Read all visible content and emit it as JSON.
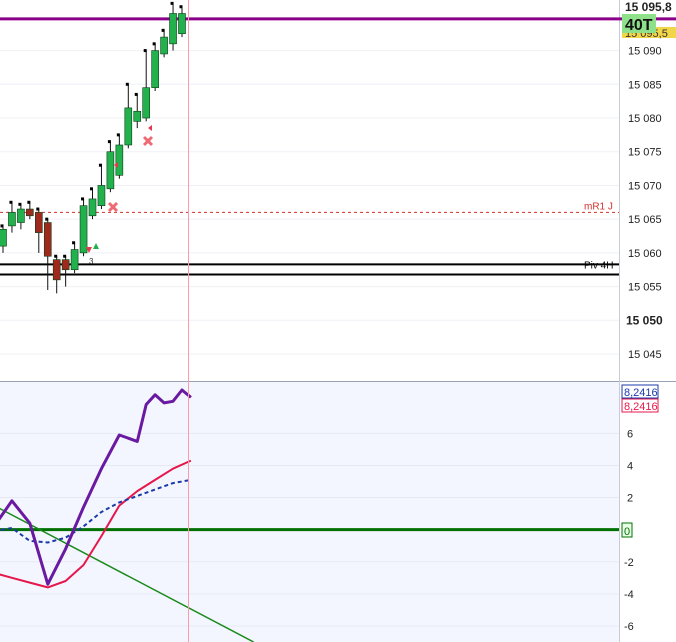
{
  "colors": {
    "bull": "#22b14c",
    "bear": "#a0291d",
    "wick": "#111111",
    "mr1": "#d0312d",
    "resistance": "#8b008b",
    "pivot": "#000000",
    "zero": "#007000",
    "trend": "#1a8a1a",
    "osc_fast": "#6a1aa0",
    "osc_slow": "#e5174b",
    "osc_signal": "#1a3aa8",
    "cursor": "#ff9aa8"
  },
  "price_axis": {
    "ticks": [
      "15 090",
      "15 085",
      "15 080",
      "15 075",
      "15 070",
      "15 065",
      "15 060",
      "15 055",
      "15 050",
      "15 045"
    ],
    "bold_tick": "15 050",
    "top_label": "15 095,8",
    "timeframe_badge": "40T",
    "last_price_badge": "15 095,5"
  },
  "osc_axis": {
    "ticks": [
      "6",
      "4",
      "2",
      "0",
      "-2",
      "-4",
      "-6"
    ],
    "value_badge_1": "8,2416",
    "value_badge_2": "8,2416",
    "zero_badge": "0"
  },
  "levels": {
    "mr1_label": "mR1 J",
    "pivot_label": "Piv 4H"
  },
  "markers": {
    "count_label": "3"
  },
  "chart_data": [
    {
      "type": "candlestick",
      "ylim": [
        15041,
        15097.5
      ],
      "resistance_level": 15094.7,
      "levels": [
        {
          "name": "mR1 J",
          "value": 15066.0,
          "style": "dashed"
        },
        {
          "name": "Piv 4H",
          "value": 15058.3,
          "style": "solid"
        },
        {
          "name": "",
          "value": 15056.8,
          "style": "solid"
        }
      ],
      "last_price": 15095.5,
      "candles": [
        {
          "o": 15061.0,
          "h": 15064.0,
          "l": 15060.0,
          "c": 15063.5
        },
        {
          "o": 15064.0,
          "h": 15067.5,
          "l": 15063.0,
          "c": 15066.0
        },
        {
          "o": 15064.5,
          "h": 15067.2,
          "l": 15063.5,
          "c": 15066.5
        },
        {
          "o": 15066.5,
          "h": 15067.5,
          "l": 15065.0,
          "c": 15065.5
        },
        {
          "o": 15066.0,
          "h": 15066.5,
          "l": 15060.0,
          "c": 15063.0
        },
        {
          "o": 15064.5,
          "h": 15065.0,
          "l": 15054.5,
          "c": 15059.5
        },
        {
          "o": 15059.0,
          "h": 15059.5,
          "l": 15054.0,
          "c": 15056.0
        },
        {
          "o": 15059.0,
          "h": 15059.5,
          "l": 15055.0,
          "c": 15057.5
        },
        {
          "o": 15057.5,
          "h": 15061.5,
          "l": 15057.0,
          "c": 15060.5
        },
        {
          "o": 15060.0,
          "h": 15068.0,
          "l": 15059.5,
          "c": 15067.0
        },
        {
          "o": 15065.5,
          "h": 15069.5,
          "l": 15065.0,
          "c": 15068.0
        },
        {
          "o": 15067.0,
          "h": 15073.0,
          "l": 15066.5,
          "c": 15070.0
        },
        {
          "o": 15069.5,
          "h": 15076.5,
          "l": 15069.0,
          "c": 15075.0
        },
        {
          "o": 15071.5,
          "h": 15077.5,
          "l": 15071.0,
          "c": 15076.0
        },
        {
          "o": 15076.0,
          "h": 15085.0,
          "l": 15075.5,
          "c": 15081.5
        },
        {
          "o": 15079.5,
          "h": 15083.5,
          "l": 15078.5,
          "c": 15081.0
        },
        {
          "o": 15080.0,
          "h": 15090.0,
          "l": 15079.5,
          "c": 15084.5
        },
        {
          "o": 15084.5,
          "h": 15091.0,
          "l": 15084.0,
          "c": 15090.0
        },
        {
          "o": 15089.5,
          "h": 15093.0,
          "l": 15089.0,
          "c": 15092.0
        },
        {
          "o": 15091.0,
          "h": 15097.0,
          "l": 15090.0,
          "c": 15095.5
        },
        {
          "o": 15092.5,
          "h": 15096.5,
          "l": 15092.0,
          "c": 15095.5
        }
      ]
    },
    {
      "type": "line",
      "ylim": [
        -7,
        9.2
      ],
      "yticks": [
        6,
        4,
        2,
        0,
        -2,
        -4,
        -6
      ],
      "zero_line": 0,
      "series": [
        {
          "role": "fast",
          "x": [
            -1,
            1,
            3,
            5,
            7,
            9,
            11,
            13,
            15,
            16,
            17,
            18,
            19,
            20,
            21
          ],
          "values": [
            0.2,
            1.8,
            0.4,
            -3.4,
            -1.2,
            1.4,
            3.8,
            5.9,
            5.5,
            7.8,
            8.4,
            7.9,
            8.0,
            8.7,
            8.24
          ]
        },
        {
          "role": "slow",
          "x": [
            -1,
            1,
            3,
            5,
            7,
            9,
            11,
            13,
            15,
            17,
            19,
            21
          ],
          "values": [
            -2.7,
            -3.0,
            -3.3,
            -3.6,
            -3.2,
            -2.2,
            -0.4,
            1.5,
            2.4,
            3.1,
            3.8,
            4.3
          ]
        },
        {
          "role": "signal",
          "x": [
            -1,
            1,
            3,
            5,
            7,
            9,
            11,
            13,
            15,
            17,
            19,
            21
          ],
          "values": [
            -0.1,
            0.1,
            -0.7,
            -0.8,
            -0.5,
            0.2,
            1.1,
            1.7,
            2.1,
            2.5,
            2.9,
            3.1
          ]
        }
      ],
      "trend_line": {
        "from": {
          "x": -1,
          "y": 1.5
        },
        "to": {
          "x": 28,
          "y": -7.0
        }
      }
    }
  ]
}
